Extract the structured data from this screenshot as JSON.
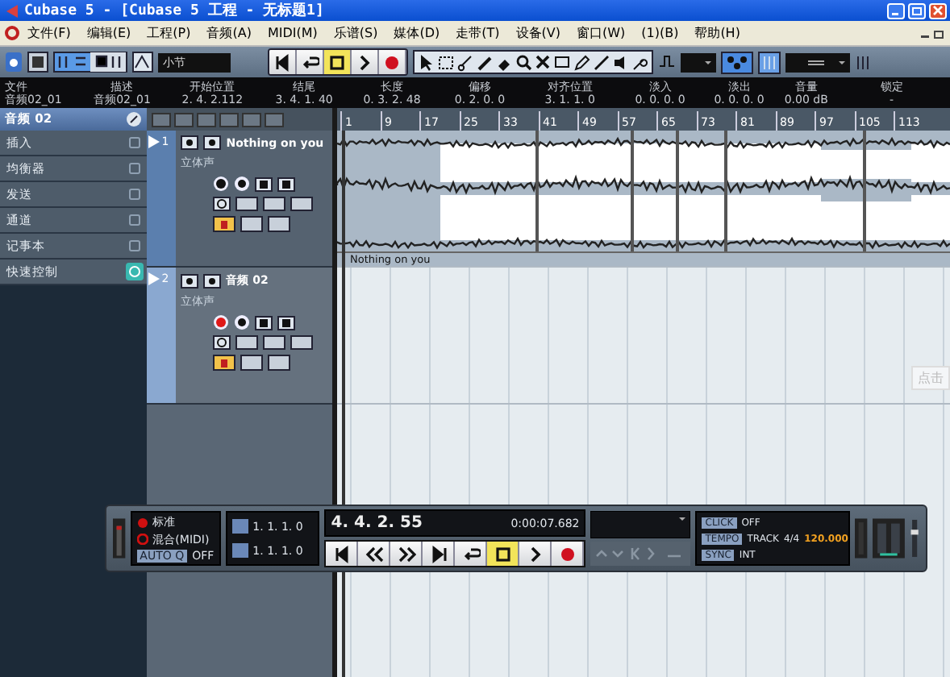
{
  "window": {
    "title": "Cubase 5 - [Cubase 5 工程 - 无标题1]"
  },
  "menu": [
    "文件(F)",
    "编辑(E)",
    "工程(P)",
    "音频(A)",
    "MIDI(M)",
    "乐谱(S)",
    "媒体(D)",
    "走带(T)",
    "设备(V)",
    "窗口(W)",
    "(1)(B)",
    "帮助(H)"
  ],
  "toolbar": {
    "grid_type": "小节",
    "buttons": [
      {
        "kind": "to-start",
        "selected": false
      },
      {
        "kind": "cycle",
        "selected": false
      },
      {
        "kind": "stop",
        "selected": true
      },
      {
        "kind": "play",
        "selected": false
      },
      {
        "kind": "record",
        "selected": false
      }
    ]
  },
  "info_line": [
    {
      "label": "文件",
      "value": "音频02_01"
    },
    {
      "label": "描述",
      "value": "音频02_01"
    },
    {
      "label": "开始位置",
      "value": "2. 4. 2.112"
    },
    {
      "label": "结尾",
      "value": "3. 4. 1. 40"
    },
    {
      "label": "长度",
      "value": "0. 3. 2. 48"
    },
    {
      "label": "偏移",
      "value": "0. 2. 0. 0"
    },
    {
      "label": "对齐位置",
      "value": "3. 1. 1. 0"
    },
    {
      "label": "淡入",
      "value": "0. 0. 0. 0"
    },
    {
      "label": "淡出",
      "value": "0. 0. 0. 0"
    },
    {
      "label": "音量",
      "value": "0.00 dB"
    },
    {
      "label": "锁定",
      "value": "-"
    }
  ],
  "inspector": {
    "track": "音频 02",
    "sections": [
      "插入",
      "均衡器",
      "发送",
      "通道",
      "记事本",
      "快速控制"
    ]
  },
  "tracks": [
    {
      "number": "1",
      "name": "Nothing on you",
      "channel": "立体声",
      "selected": false,
      "record_enabled": false
    },
    {
      "number": "2",
      "name": "音频 02",
      "channel": "立体声",
      "selected": true,
      "record_enabled": true
    }
  ],
  "ruler": [
    "1",
    "9",
    "17",
    "25",
    "33",
    "41",
    "49",
    "57",
    "65",
    "73",
    "81",
    "89",
    "97",
    "105",
    "113"
  ],
  "event": {
    "name": "Nothing on you"
  },
  "tooltip": "点击",
  "transport": {
    "mode": "标准",
    "mix": "混合(MIDI)",
    "auto_quantize": "AUTO Q",
    "auto_state": "OFF",
    "left_locator": "1. 1. 1. 0",
    "right_locator": "1. 1. 1. 0",
    "position": "4. 4. 2. 55",
    "time": "0:00:07.682",
    "click": "CLICK",
    "click_state": "OFF",
    "tempo": "TEMPO",
    "tempo_mode": "TRACK",
    "signature": "4/4",
    "bpm": "120.000",
    "sync": "SYNC",
    "sync_mode": "INT",
    "buttons": [
      {
        "kind": "to-start",
        "selected": false
      },
      {
        "kind": "rewind",
        "selected": false
      },
      {
        "kind": "forward",
        "selected": false
      },
      {
        "kind": "to-end",
        "selected": false
      },
      {
        "kind": "cycle",
        "selected": false
      },
      {
        "kind": "stop",
        "selected": true
      },
      {
        "kind": "play",
        "selected": false
      },
      {
        "kind": "record",
        "selected": false
      }
    ]
  }
}
